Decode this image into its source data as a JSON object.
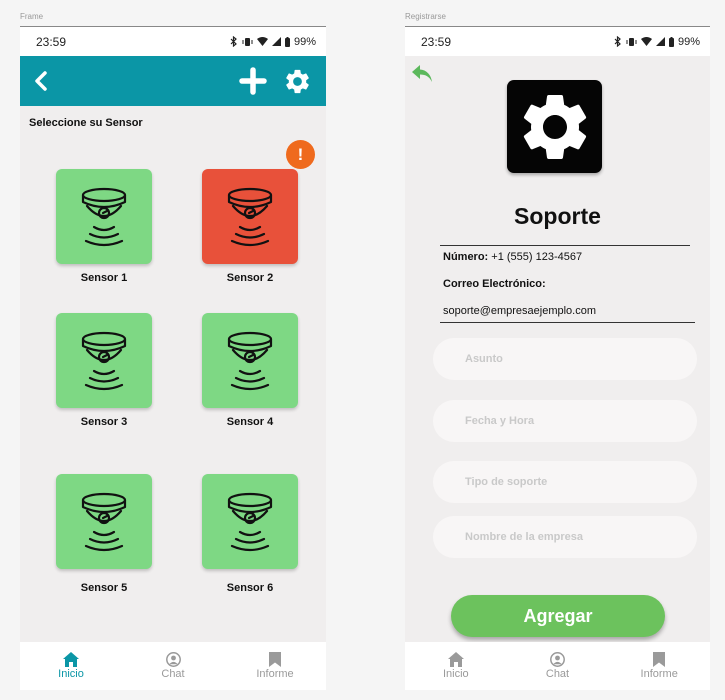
{
  "left_screen": {
    "frame_label": "Frame",
    "status": {
      "time": "23:59",
      "battery": "99%"
    },
    "section_title": "Seleccione su Sensor",
    "alert_badge": "!",
    "sensors": [
      {
        "label": "Sensor 1",
        "state": "ok"
      },
      {
        "label": "Sensor 2",
        "state": "alert"
      },
      {
        "label": "Sensor 3",
        "state": "ok"
      },
      {
        "label": "Sensor 4",
        "state": "ok"
      },
      {
        "label": "Sensor 5",
        "state": "ok"
      },
      {
        "label": "Sensor 6",
        "state": "ok"
      }
    ],
    "nav": [
      {
        "label": "Inicio",
        "icon": "home-icon",
        "active": true
      },
      {
        "label": "Chat",
        "icon": "user-icon",
        "active": false
      },
      {
        "label": "Informe",
        "icon": "bookmark-icon",
        "active": false
      }
    ]
  },
  "right_screen": {
    "frame_label": "Registrarse",
    "status": {
      "time": "23:59",
      "battery": "99%"
    },
    "title": "Soporte",
    "phone_label": "Número:",
    "phone_value": "+1 (555) 123-4567",
    "email_label": "Correo Electrónico:",
    "email_value": "soporte@empresaejemplo.com",
    "fields": {
      "subject_placeholder": "Asunto",
      "datetime_placeholder": "Fecha y Hora",
      "support_type_placeholder": "Tipo de soporte",
      "company_placeholder": "Nombre de la empresa"
    },
    "submit_label": "Agregar",
    "nav": [
      {
        "label": "Inicio",
        "icon": "home-icon",
        "active": false
      },
      {
        "label": "Chat",
        "icon": "user-icon",
        "active": false
      },
      {
        "label": "Informe",
        "icon": "bookmark-icon",
        "active": false
      }
    ]
  },
  "colors": {
    "primary_teal": "#0b96a6",
    "sensor_ok": "#7ed884",
    "sensor_alert": "#e8513a",
    "alert_badge": "#ef6a1d",
    "button_green": "#6cc25d",
    "back_arrow": "#5cb85c"
  }
}
